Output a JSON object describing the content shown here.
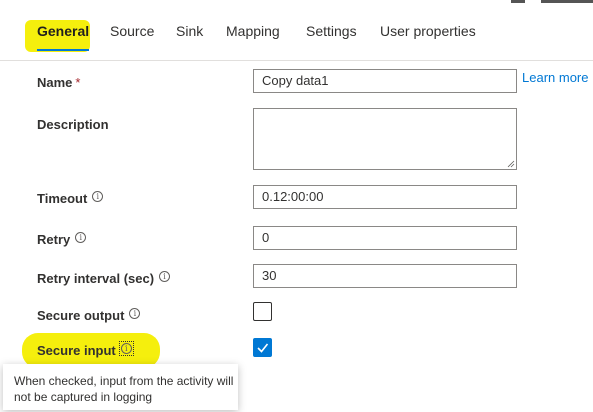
{
  "tabs": [
    {
      "label": "General",
      "active": true
    },
    {
      "label": "Source",
      "active": false
    },
    {
      "label": "Sink",
      "active": false
    },
    {
      "label": "Mapping",
      "active": false
    },
    {
      "label": "Settings",
      "active": false
    },
    {
      "label": "User properties",
      "active": false
    }
  ],
  "form": {
    "name_label": "Name",
    "required_marker": "*",
    "name_value": "Copy data1",
    "learn_more": "Learn more",
    "description_label": "Description",
    "description_value": "",
    "timeout_label": "Timeout",
    "timeout_value": "0.12:00:00",
    "retry_label": "Retry",
    "retry_value": "0",
    "retry_interval_label": "Retry interval (sec)",
    "retry_interval_value": "30",
    "secure_output_label": "Secure output",
    "secure_output_checked": false,
    "secure_input_label": "Secure input",
    "secure_input_checked": true
  },
  "tooltip": {
    "text": "When checked, input from the activity will not be captured in logging"
  },
  "icons": {
    "info": "info-icon",
    "checkmark": "checkmark-icon",
    "resize": "resize-grip-icon"
  },
  "colors": {
    "accent": "#0078d4",
    "highlight": "#f4ee00",
    "required": "#a4262c",
    "link": "#0078d4"
  }
}
